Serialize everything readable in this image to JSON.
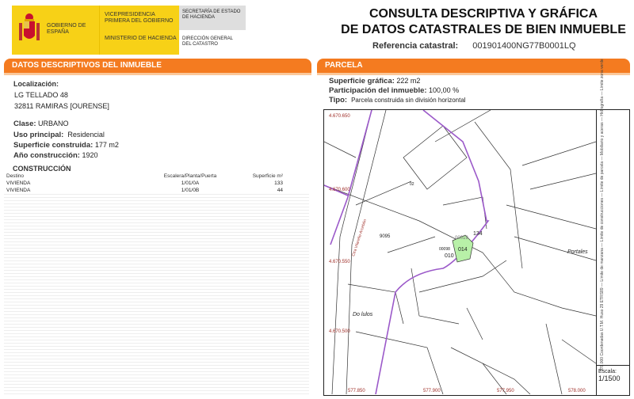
{
  "header": {
    "logo": {
      "gobierno": "GOBIERNO DE ESPAÑA",
      "vicepresidencia": "VICEPRESIDENCIA PRIMERA DEL GOBIERNO",
      "ministerio": "MINISTERIO DE HACIENDA",
      "secretaria": "SECRETARÍA DE ESTADO DE HACIENDA",
      "direccion": "DIRECCIÓN GENERAL DEL CATASTRO"
    },
    "title_line1": "CONSULTA DESCRIPTIVA Y GRÁFICA",
    "title_line2": "DE DATOS CATASTRALES DE BIEN INMUEBLE",
    "ref_label": "Referencia catastral:",
    "ref_value": "001901400NG77B0001LQ"
  },
  "descriptive": {
    "header": "DATOS DESCRIPTIVOS DEL INMUEBLE",
    "localizacion_label": "Localización:",
    "address_line1": "LG TELLADO 48",
    "address_line2": "32811 RAMIRAS [OURENSE]",
    "clase_label": "Clase:",
    "clase": "URBANO",
    "uso_label": "Uso principal:",
    "uso": "Residencial",
    "sup_label": "Superficie construida:",
    "sup": "177 m2",
    "anio_label": "Año construcción:",
    "anio": "1920",
    "construccion_title": "CONSTRUCCIÓN",
    "table": {
      "headers": [
        "Destino",
        "Escalera/Planta/Puerta",
        "Superficie m²"
      ],
      "rows": [
        [
          "VIVIENDA",
          "1/01/0A",
          "133"
        ],
        [
          "VIVIENDA",
          "1/01/0B",
          "44"
        ]
      ]
    }
  },
  "parcela": {
    "header": "PARCELA",
    "sup_label": "Superficie gráfica:",
    "sup": "222 m2",
    "part_label": "Participación del inmueble:",
    "part": "100,00 %",
    "tipo_label": "Tipo:",
    "tipo": "Parcela construida sin división horizontal"
  },
  "map": {
    "y_coords": [
      "4.670.650",
      "4.670.600",
      "4.670.550",
      "4.670.500"
    ],
    "x_coords": [
      "577.850",
      "577.900",
      "577.950",
      "578.000"
    ],
    "labels": {
      "street": "Ctra Vilarello-Arcebón",
      "plot": "014",
      "plot_a": "010",
      "plot_b": "134",
      "plot_c": "00019",
      "plot_d": "9095",
      "plot_e": "00098",
      "plot_f": "02",
      "place1": "Do lulos",
      "place2": "Portales"
    },
    "legend": "578.000 Coordenadas U.T.M. Huso 29 ETRS89   — Límite de manzana   — Límite de construcciones   — Límite de parcela   — Mobiliario y aceras   — Hidrografía   — Límite zona verde",
    "scale_label": "Escala:",
    "scale": "1/1500",
    "colors": {
      "street_boundary": "#9b59c9",
      "highlight_plot": "#b8f0a8",
      "coord_text": "#a0302a"
    }
  }
}
